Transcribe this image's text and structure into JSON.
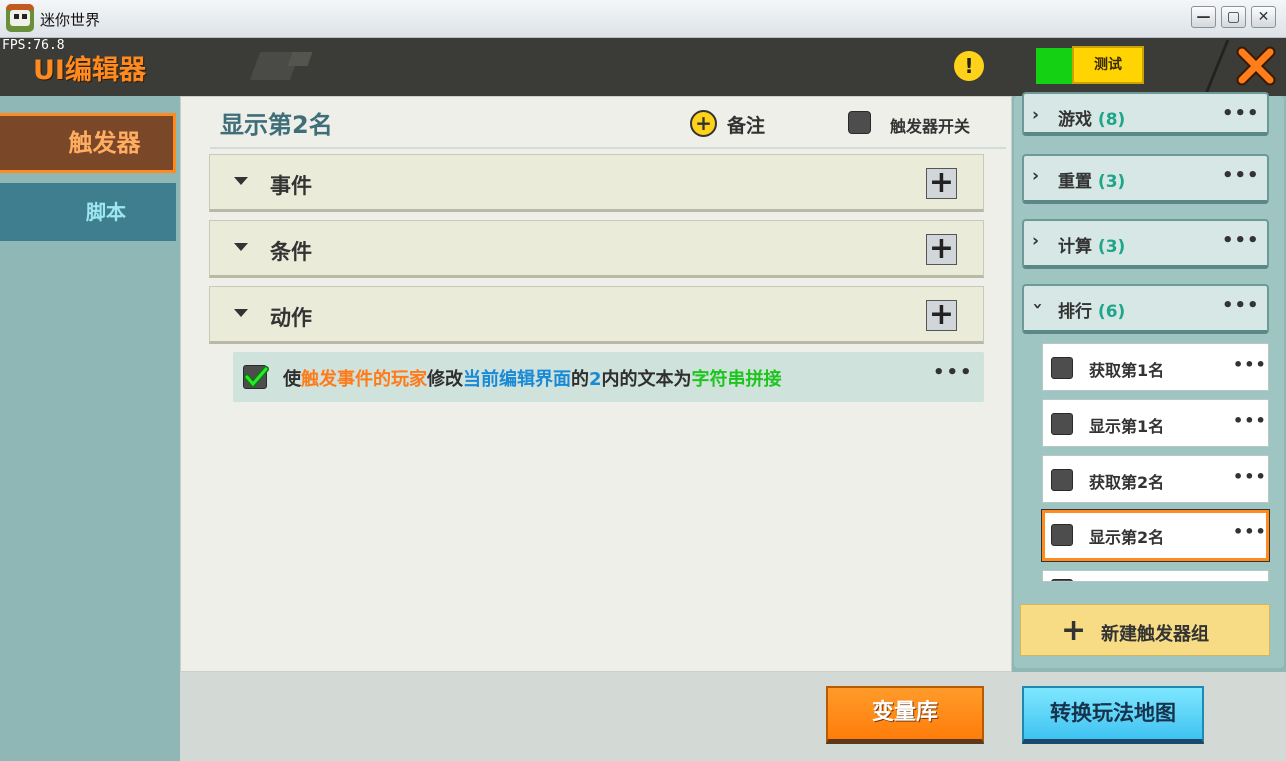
{
  "window": {
    "title": "迷你世界",
    "minimize": "—",
    "maximize": "▢",
    "close": "✕"
  },
  "header": {
    "fps": "FPS:76.8",
    "title": "UI编辑器",
    "warning_glyph": "!",
    "test_label": "测试",
    "accent_color": "#ff8a1f"
  },
  "nav": {
    "items": [
      {
        "label": "触发器",
        "active": true
      },
      {
        "label": "脚本",
        "active": false
      }
    ]
  },
  "main": {
    "title": "显示第2名",
    "note_label": "备注",
    "trigger_switch_label": "触发器开关",
    "sections": [
      {
        "label": "事件"
      },
      {
        "label": "条件"
      },
      {
        "label": "动作"
      }
    ],
    "action": {
      "checked": true,
      "parts": [
        {
          "text": "使",
          "color": "dark"
        },
        {
          "text": "触发事件的玩家",
          "color": "orange"
        },
        {
          "text": "修改",
          "color": "dark"
        },
        {
          "text": "当前编辑界面",
          "color": "blue"
        },
        {
          "text": "的",
          "color": "dark"
        },
        {
          "text": "2",
          "color": "blue"
        },
        {
          "text": "内的文本为",
          "color": "dark"
        },
        {
          "text": "字符串拼接",
          "color": "green"
        }
      ],
      "more": "•••"
    }
  },
  "sidebar": {
    "categories": [
      {
        "name": "游戏",
        "count": "(8)",
        "expanded": false
      },
      {
        "name": "重置",
        "count": "(3)",
        "expanded": false
      },
      {
        "name": "计算",
        "count": "(3)",
        "expanded": false
      },
      {
        "name": "排行",
        "count": "(6)",
        "expanded": true
      }
    ],
    "triggers": [
      {
        "label": "获取第1名",
        "selected": false
      },
      {
        "label": "显示第1名",
        "selected": false
      },
      {
        "label": "获取第2名",
        "selected": false
      },
      {
        "label": "显示第2名",
        "selected": true
      }
    ],
    "more": "•••",
    "new_group_label": "新建触发器组"
  },
  "footer": {
    "variables_label": "变量库",
    "convert_label": "转换玩法地图"
  }
}
